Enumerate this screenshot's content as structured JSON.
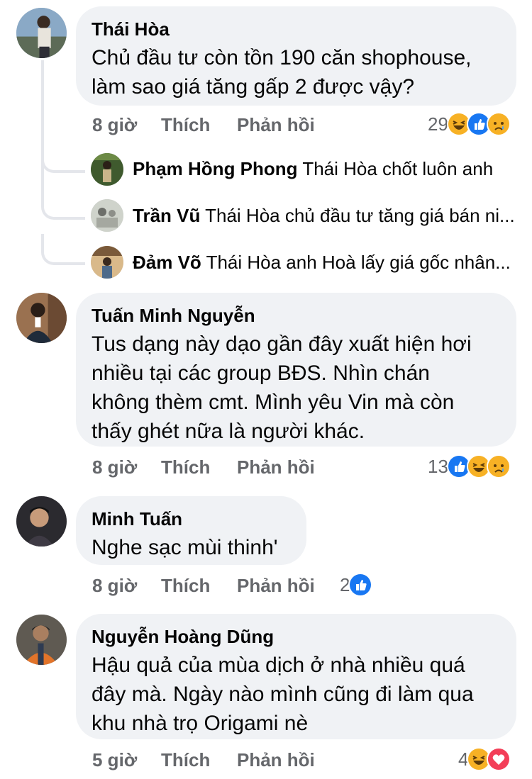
{
  "comments": [
    {
      "name": "Thái Hòa",
      "text": "Chủ đầu tư còn tồn 190 căn shophouse,\nlàm sao giá tăng gấp 2 được vậy?",
      "time": "8 giờ",
      "like_label": "Thích",
      "reply_label": "Phản hồi",
      "reaction_count": "29",
      "reactions": [
        "haha",
        "like",
        "sad"
      ],
      "replies": [
        {
          "name": "Phạm Hồng Phong",
          "text": "Thái Hòa chốt luôn anh"
        },
        {
          "name": "Trần Vũ",
          "text": "Thái Hòa chủ đầu tư tăng giá bán ni..."
        },
        {
          "name": "Đảm Võ",
          "text": "Thái Hòa  anh Hoà lấy giá gốc nhân..."
        }
      ]
    },
    {
      "name": "Tuấn Minh Nguyễn",
      "text": "Tus dạng này dạo gần đây xuất hiện hơi\nnhiều tại các group BĐS. Nhìn chán\nkhông thèm cmt. Mình yêu Vin mà còn\nthấy ghét nữa là người khác.",
      "time": "8 giờ",
      "like_label": "Thích",
      "reply_label": "Phản hồi",
      "reaction_count": "13",
      "reactions": [
        "like",
        "haha",
        "sad"
      ]
    },
    {
      "name": "Minh Tuấn",
      "text": "Nghe sạc mùi thinh'",
      "time": "8 giờ",
      "like_label": "Thích",
      "reply_label": "Phản hồi",
      "reaction_count": "2",
      "reactions": [
        "like"
      ]
    },
    {
      "name": "Nguyễn Hoàng Dũng",
      "text": "Hậu quả của mùa dịch ở nhà nhiều quá\nđây mà. Ngày nào mình cũng đi làm qua\nkhu nhà trọ Origami nè",
      "time": "5 giờ",
      "like_label": "Thích",
      "reply_label": "Phản hồi",
      "reaction_count": "4",
      "reactions": [
        "haha",
        "love"
      ]
    }
  ],
  "colors": {
    "bubble": "#f0f2f5",
    "meta_text": "#65676b",
    "like_blue": "#1877f2",
    "haha_yellow": "#f7b125",
    "love_red": "#f33e58"
  }
}
